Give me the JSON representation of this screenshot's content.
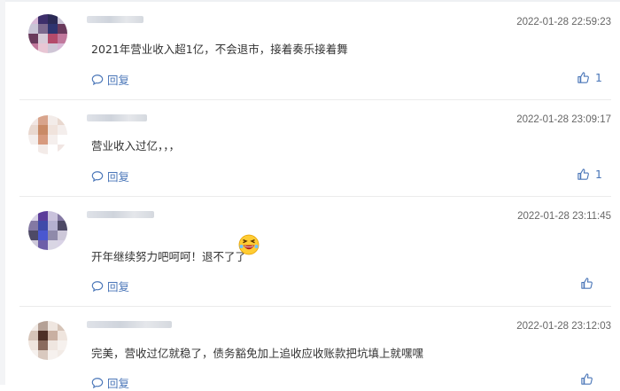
{
  "comments": [
    {
      "timestamp": "2022-01-28 22:59:23",
      "text": "2021年营业收入超1亿，不会退市，接着奏乐接着舞",
      "reply_label": "回复",
      "like_count": "1",
      "avatar_colors": [
        "#d8b8d6",
        "#3d2f6b",
        "#2b2a55",
        "#c9c4d6",
        "#7d6a8f",
        "#2e3470",
        "#6a3a5c",
        "#d7cbd8",
        "#b44a6a",
        "#c1789c",
        "#e8c6d4",
        "#cfc6d6"
      ]
    },
    {
      "timestamp": "2022-01-28 23:09:17",
      "text": "营业收入过亿，，，",
      "reply_label": "回复",
      "like_count": "1",
      "avatar_colors": [
        "#f1e6e3",
        "#d8a48c",
        "#f3ece9",
        "#e9d8cf",
        "#c98a66",
        "#f0e3dc",
        "#f4eeec",
        "#d79a7e",
        "#f5efed",
        "#ffffff",
        "#f3ebe8",
        "#ffffff"
      ]
    },
    {
      "timestamp": "2022-01-28 23:11:45",
      "text": "开年继续努力吧呵呵！退不了了",
      "reply_label": "回复",
      "like_count": "",
      "emoji": "laughing-face",
      "avatar_colors": [
        "#d9d3e6",
        "#5b3c9a",
        "#c9c2dc",
        "#8479a3",
        "#3f4aa9",
        "#b4b0d0",
        "#4e4a66",
        "#4a57d0",
        "#8f8aaa",
        "#cdc8d9",
        "#6d5fa8",
        "#d9d6e4"
      ]
    },
    {
      "timestamp": "2022-01-28 23:12:03",
      "text": "完美，营收过亿就稳了，债务豁免加上追收应收账款把坑填上就嘿嘿",
      "reply_label": "回复",
      "like_count": "",
      "avatar_colors": [
        "#f2ebe6",
        "#b5a196",
        "#efe6e0",
        "#d6c4b8",
        "#4d2f26",
        "#c9b0a2",
        "#efe5de",
        "#8a6b5e",
        "#efe6e0",
        "#f6f1ee",
        "#d9c9bf",
        "#f6f1ee"
      ]
    }
  ]
}
